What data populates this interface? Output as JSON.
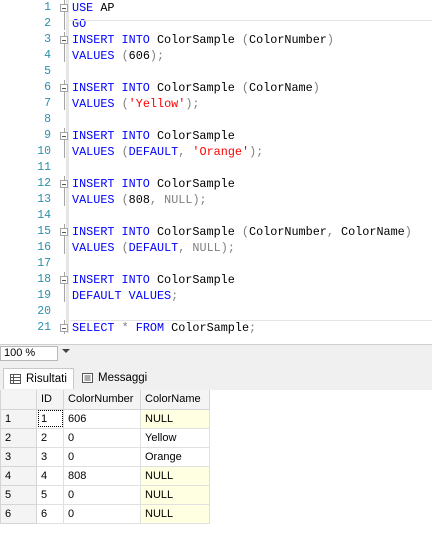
{
  "editor": {
    "lines": [
      {
        "n": "1",
        "tokens": [
          {
            "t": "USE",
            "c": "kw"
          },
          {
            "t": " AP"
          }
        ]
      },
      {
        "n": "2",
        "tokens": [
          {
            "t": "GO",
            "c": "kw"
          }
        ]
      },
      {
        "n": "3",
        "tokens": [
          {
            "t": "INSERT INTO",
            "c": "kw"
          },
          {
            "t": " ColorSample "
          },
          {
            "t": "(",
            "c": "op"
          },
          {
            "t": "ColorNumber"
          },
          {
            "t": ")",
            "c": "op"
          }
        ]
      },
      {
        "n": "4",
        "tokens": [
          {
            "t": "VALUES",
            "c": "kw"
          },
          {
            "t": " "
          },
          {
            "t": "(",
            "c": "op"
          },
          {
            "t": "606"
          },
          {
            "t": ");",
            "c": "op"
          }
        ]
      },
      {
        "n": "5",
        "tokens": []
      },
      {
        "n": "6",
        "tokens": [
          {
            "t": "INSERT INTO",
            "c": "kw"
          },
          {
            "t": " ColorSample "
          },
          {
            "t": "(",
            "c": "op"
          },
          {
            "t": "ColorName"
          },
          {
            "t": ")",
            "c": "op"
          }
        ]
      },
      {
        "n": "7",
        "tokens": [
          {
            "t": "VALUES",
            "c": "kw"
          },
          {
            "t": " "
          },
          {
            "t": "(",
            "c": "op"
          },
          {
            "t": "'Yellow'",
            "c": "str"
          },
          {
            "t": ");",
            "c": "op"
          }
        ]
      },
      {
        "n": "8",
        "tokens": []
      },
      {
        "n": "9",
        "tokens": [
          {
            "t": "INSERT INTO",
            "c": "kw"
          },
          {
            "t": " ColorSample"
          }
        ]
      },
      {
        "n": "10",
        "tokens": [
          {
            "t": "VALUES",
            "c": "kw"
          },
          {
            "t": " "
          },
          {
            "t": "(",
            "c": "op"
          },
          {
            "t": "DEFAULT",
            "c": "kw"
          },
          {
            "t": ",",
            "c": "op"
          },
          {
            "t": " "
          },
          {
            "t": "'Orange'",
            "c": "str"
          },
          {
            "t": ");",
            "c": "op"
          }
        ]
      },
      {
        "n": "11",
        "tokens": []
      },
      {
        "n": "12",
        "tokens": [
          {
            "t": "INSERT INTO",
            "c": "kw"
          },
          {
            "t": " ColorSample"
          }
        ]
      },
      {
        "n": "13",
        "tokens": [
          {
            "t": "VALUES",
            "c": "kw"
          },
          {
            "t": " "
          },
          {
            "t": "(",
            "c": "op"
          },
          {
            "t": "808"
          },
          {
            "t": ",",
            "c": "op"
          },
          {
            "t": " "
          },
          {
            "t": "NULL",
            "c": "op"
          },
          {
            "t": ");",
            "c": "op"
          }
        ]
      },
      {
        "n": "14",
        "tokens": []
      },
      {
        "n": "15",
        "tokens": [
          {
            "t": "INSERT INTO",
            "c": "kw"
          },
          {
            "t": " ColorSample "
          },
          {
            "t": "(",
            "c": "op"
          },
          {
            "t": "ColorNumber"
          },
          {
            "t": ",",
            "c": "op"
          },
          {
            "t": " ColorName"
          },
          {
            "t": ")",
            "c": "op"
          }
        ]
      },
      {
        "n": "16",
        "tokens": [
          {
            "t": "VALUES",
            "c": "kw"
          },
          {
            "t": " "
          },
          {
            "t": "(",
            "c": "op"
          },
          {
            "t": "DEFAULT",
            "c": "kw"
          },
          {
            "t": ",",
            "c": "op"
          },
          {
            "t": " "
          },
          {
            "t": "NULL",
            "c": "op"
          },
          {
            "t": ");",
            "c": "op"
          }
        ]
      },
      {
        "n": "17",
        "tokens": []
      },
      {
        "n": "18",
        "tokens": [
          {
            "t": "INSERT INTO",
            "c": "kw"
          },
          {
            "t": " ColorSample"
          }
        ]
      },
      {
        "n": "19",
        "tokens": [
          {
            "t": "DEFAULT VALUES",
            "c": "kw"
          },
          {
            "t": ";",
            "c": "op"
          }
        ]
      },
      {
        "n": "20",
        "tokens": []
      },
      {
        "n": "21",
        "tokens": [
          {
            "t": "SELECT",
            "c": "kw"
          },
          {
            "t": " "
          },
          {
            "t": "*",
            "c": "op"
          },
          {
            "t": " "
          },
          {
            "t": "FROM",
            "c": "kw"
          },
          {
            "t": " ColorSample"
          },
          {
            "t": ";",
            "c": "op"
          }
        ]
      }
    ]
  },
  "colors": {
    "keyword": "#0000ff",
    "operator": "#808080",
    "string": "#ff0000",
    "line_number": "#2b91af",
    "null_cell": "#ffffe1"
  },
  "zoom": {
    "value": "100 %"
  },
  "tabs": [
    {
      "label": "Risultati",
      "icon": "grid-icon"
    },
    {
      "label": "Messaggi",
      "icon": "messages-icon"
    }
  ],
  "results": {
    "columns": [
      "ID",
      "ColorNumber",
      "ColorName"
    ],
    "rows": [
      {
        "rownum": "1",
        "cells": [
          "1",
          "606",
          "NULL"
        ]
      },
      {
        "rownum": "2",
        "cells": [
          "2",
          "0",
          "Yellow"
        ]
      },
      {
        "rownum": "3",
        "cells": [
          "3",
          "0",
          "Orange"
        ]
      },
      {
        "rownum": "4",
        "cells": [
          "4",
          "808",
          "NULL"
        ]
      },
      {
        "rownum": "5",
        "cells": [
          "5",
          "0",
          "NULL"
        ]
      },
      {
        "rownum": "6",
        "cells": [
          "6",
          "0",
          "NULL"
        ]
      }
    ]
  }
}
